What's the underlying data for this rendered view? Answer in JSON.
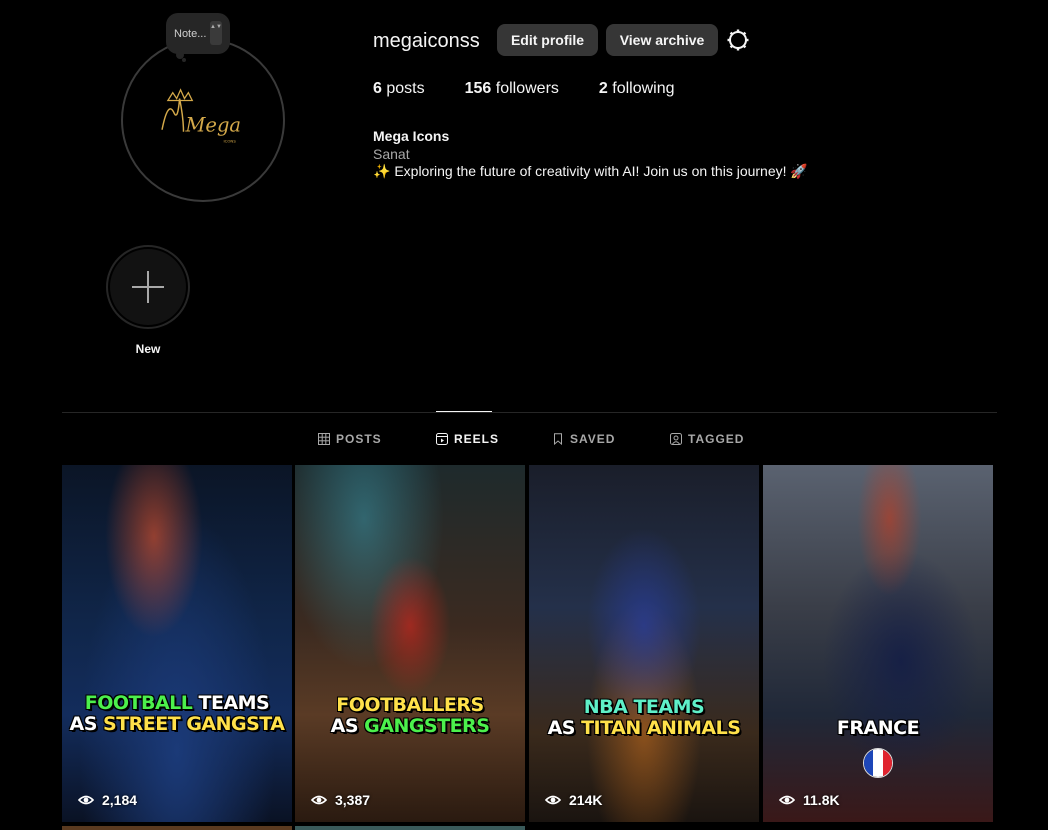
{
  "note": {
    "text": "Note...",
    "arrows": "▲▼"
  },
  "profile": {
    "username": "megaiconss",
    "edit_label": "Edit profile",
    "archive_label": "View archive",
    "logo_text": "Mega",
    "logo_small": "ICONS",
    "stats": {
      "posts_count": "6",
      "posts_label": "posts",
      "followers_count": "156",
      "followers_label": "followers",
      "following_count": "2",
      "following_label": "following"
    },
    "full_name": "Mega Icons",
    "subtitle": "Sanat",
    "bio": "✨ Exploring the future of creativity with AI! Join us on this journey! 🚀"
  },
  "highlight": {
    "label": "New"
  },
  "tabs": [
    {
      "label": "POSTS",
      "icon": "grid-icon"
    },
    {
      "label": "REELS",
      "icon": "reels-icon"
    },
    {
      "label": "SAVED",
      "icon": "bookmark-icon"
    },
    {
      "label": "TAGGED",
      "icon": "tag-icon"
    }
  ],
  "reels": [
    {
      "line1a": "FOOTBALL",
      "line1b": " TEAMS",
      "line2a": "AS ",
      "line2b": "STREET GANGSTA",
      "views": "2,184"
    },
    {
      "line1a": "FOOTBALLERS",
      "line2a": "AS ",
      "line2b": "GANGSTERS",
      "views": "3,387"
    },
    {
      "line1a": "NBA TEAMS",
      "line2a": "AS ",
      "line2b": "TITAN ANIMALS",
      "views": "214K"
    },
    {
      "line1a": "FRANCE",
      "views": "11.8K"
    }
  ],
  "colors": {
    "accent_green": "#4cf04c",
    "accent_yellow": "#ffe14a",
    "button_bg": "#363636"
  }
}
